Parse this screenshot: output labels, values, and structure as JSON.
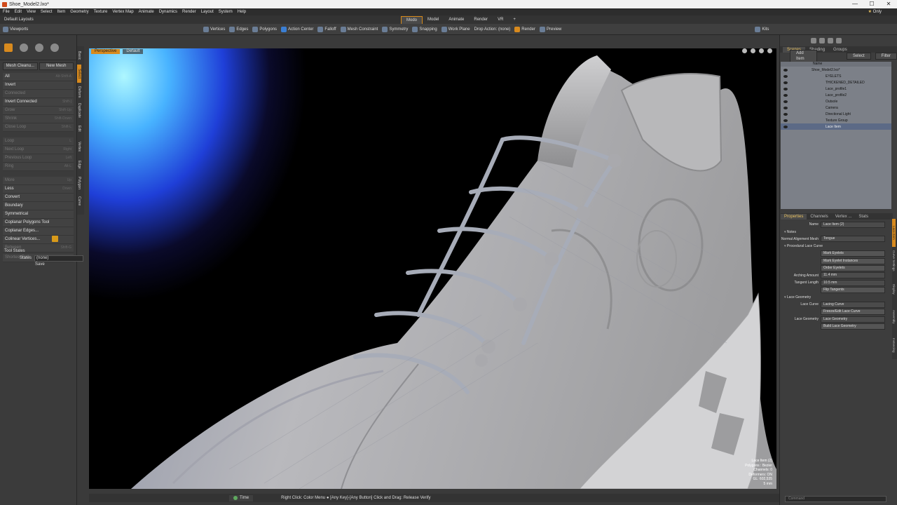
{
  "window": {
    "title": "Shoe_Model2.lxo*",
    "controls": [
      "—",
      "☐",
      "✕"
    ]
  },
  "menu": {
    "items": [
      "File",
      "Edit",
      "View",
      "Select",
      "Item",
      "Geometry",
      "Texture",
      "Vertex Map",
      "Animate",
      "Dynamics",
      "Render",
      "Layout",
      "System",
      "Help"
    ],
    "only_label": "Only"
  },
  "layout": {
    "name": "Default Layouts",
    "tabs": [
      "Modo",
      "Model",
      "Animate",
      "Render",
      "VR",
      "+"
    ],
    "active_tab": "Modo"
  },
  "toolbar": {
    "left_label": "Viewports",
    "vertices": "Vertices",
    "edges": "Edges",
    "polygons": "Polygons",
    "action_center": "Action Center",
    "falloff": "Falloff",
    "mesh_constraint": "Mesh Constraint",
    "symmetry": "Symmetry",
    "snapping": "Snapping",
    "work_plane": "Work Plane",
    "drop_action": "Drop Action: (none)",
    "render": "Render",
    "preview": "Preview",
    "kits": "Kits"
  },
  "left_panel": {
    "btn_mesh_cleanup": "Mesh Cleanu...",
    "btn_new_mesh": "New Mesh",
    "rows": [
      {
        "label": "All",
        "shortcut": "Alt-Shift-A",
        "dim": false
      },
      {
        "label": "Invert",
        "shortcut": "",
        "dim": false
      },
      {
        "label": "Connected",
        "shortcut": "",
        "dim": true
      },
      {
        "label": "Invert Connected",
        "shortcut": "Shift-]",
        "dim": false
      },
      {
        "label": "Grow",
        "shortcut": "Shift-Up",
        "dim": true
      },
      {
        "label": "Shrink",
        "shortcut": "Shift-Down",
        "dim": true
      },
      {
        "label": "Close Loop",
        "shortcut": "Shift-L",
        "dim": true
      }
    ],
    "rows2": [
      {
        "label": "Loop",
        "shortcut": "L",
        "dim": true
      },
      {
        "label": "Next Loop",
        "shortcut": "Right",
        "dim": true
      },
      {
        "label": "Previous Loop",
        "shortcut": "Left",
        "dim": true
      },
      {
        "label": "Ring",
        "shortcut": "Alt-L",
        "dim": true
      }
    ],
    "rows3": [
      {
        "label": "More",
        "shortcut": "Up",
        "dim": true
      },
      {
        "label": "Less",
        "shortcut": "Down",
        "dim": false
      },
      {
        "label": "Convert",
        "shortcut": "",
        "dim": false
      },
      {
        "label": "Boundary",
        "shortcut": "",
        "dim": false
      },
      {
        "label": "Symmetrical",
        "shortcut": "",
        "dim": false
      },
      {
        "label": "Coplanar Polygons Tool",
        "shortcut": "",
        "dim": false
      },
      {
        "label": "Coplanar Edges...",
        "shortcut": "",
        "dim": false
      },
      {
        "label": "Colinear Vertices...",
        "shortcut": "",
        "dim": false
      },
      {
        "label": "Between",
        "shortcut": "Shift-G",
        "dim": true
      }
    ],
    "shortest_path": "Shortest Path",
    "tool_states_header": "Tool States",
    "states_label": "States",
    "states_value": "(none)",
    "save_label": "Save",
    "vertical_tabs": [
      "Basic",
      "Select",
      "Deform",
      "Duplicate",
      "Edit",
      "Vertex",
      "Edge",
      "Polygon",
      "Curve",
      "Fusion"
    ]
  },
  "viewport": {
    "view_name": "Perspective",
    "shading": "Default",
    "info": {
      "item": "Lace Item (2)",
      "polygons": "Polygons : Bezier",
      "channels": "Channels: 0",
      "deformers": "Deformers: ON",
      "gl": "GL: 602,535",
      "unit": "5 mm"
    }
  },
  "right_panel": {
    "tabs": [
      "Scenes",
      "Shading",
      "Groups"
    ],
    "add_item": "Add Item",
    "select": "Select",
    "filter": "Filter",
    "tree_header": "Name",
    "tree": [
      {
        "label": "Shoe_Model2.lxo*",
        "sel": false
      },
      {
        "label": "EYELETS",
        "sel": false
      },
      {
        "label": "THICKENED_DETAILED",
        "sel": false
      },
      {
        "label": "Lace_profile1",
        "sel": false
      },
      {
        "label": "Lace_profile2",
        "sel": false
      },
      {
        "label": "Outsole",
        "sel": false
      },
      {
        "label": "Camera",
        "sel": false
      },
      {
        "label": "Directional Light",
        "sel": false
      },
      {
        "label": "Texture Group",
        "sel": false
      },
      {
        "label": "Lace Item",
        "sel": true
      }
    ],
    "prop_tabs": [
      "Properties",
      "Channels",
      "Vertex ...",
      "Stats"
    ],
    "props": {
      "name_label": "Name",
      "name_value": "Lace Item (2)",
      "notes": "Notes",
      "normal_label": "Normal Alignment Mesh",
      "normal_value": "Tongue",
      "procedural": "Procedural Lace Curve",
      "mark_eyelets": "Mark Eyelets",
      "mark_eyelet_instances": "Mark Eyelet Instances",
      "order_eyelets": "Order Eyelets",
      "arching_label": "Arching Amount",
      "arching_value": "11.4 mm",
      "tangent_label": "Tangent Length",
      "tangent_value": "10.5 mm",
      "flip_tangents": "Flip Tangents",
      "lace_geometry_header": "Lace Geometry",
      "lace_curve_label": "Lace Curve",
      "lace_curve_value": "Lacing Curve",
      "freeze_edit": "Freeze/Edit Lace Curve",
      "lace_geometry_label": "Lace Geometry",
      "lace_geometry_value": "Lace Geometry",
      "build_lace": "Build Lace Geometry"
    },
    "side_tabs": [
      "Lace Item",
      "Curve Settings",
      "Display",
      "Assembly",
      "Instancing"
    ]
  },
  "bottom": {
    "time": "Time",
    "hint": "Right Click: Color Menu ● [Any Key]-[Any Button] Click and Drag: Release Verify",
    "command_placeholder": "Command"
  }
}
